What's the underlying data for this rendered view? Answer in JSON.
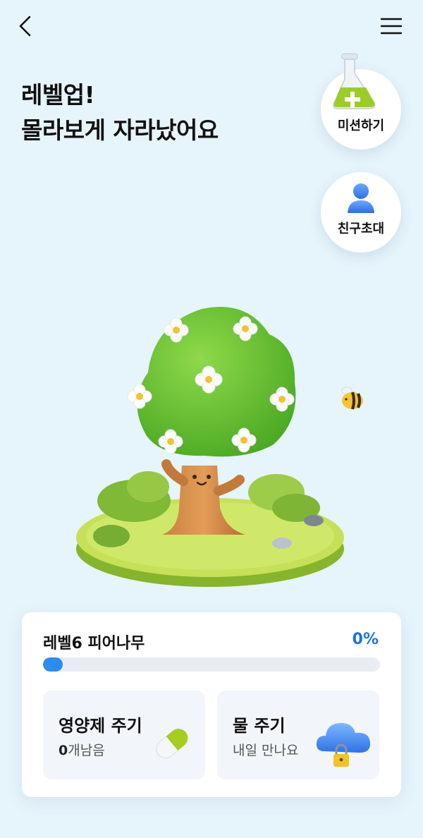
{
  "header": {
    "back_icon": "chevron-left-icon",
    "menu_icon": "hamburger-menu-icon"
  },
  "headline": {
    "line1": "레벨업!",
    "line2": "몰라보게 자라났어요"
  },
  "side_buttons": {
    "mission": {
      "label": "미션하기",
      "icon": "flask-icon"
    },
    "invite": {
      "label": "친구초대",
      "icon": "person-icon"
    }
  },
  "tree": {
    "image": "tree-illustration",
    "bee_icon": "bee-icon"
  },
  "level_card": {
    "title": "레벨6 피어나무",
    "percent_text": "0%",
    "progress": 0,
    "accent": "#1a73e8",
    "nutrient": {
      "title": "영양제 주기",
      "count": "0",
      "count_suffix": "개남음",
      "icon": "capsule-icon"
    },
    "water": {
      "title": "물 주기",
      "subtitle": "내일 만나요",
      "icon": "cloud-lock-icon"
    }
  }
}
